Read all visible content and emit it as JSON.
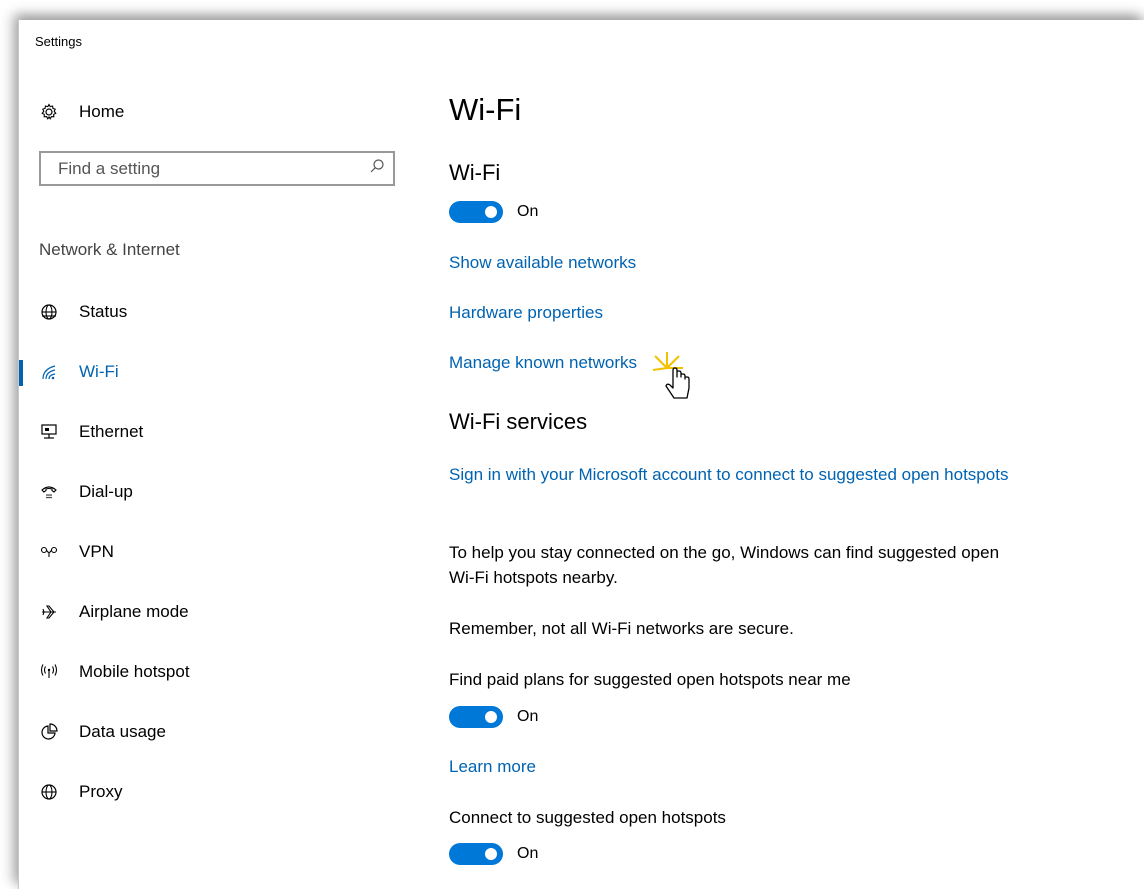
{
  "window": {
    "title": "Settings"
  },
  "sidebar": {
    "home_label": "Home",
    "search": {
      "placeholder": "Find a setting"
    },
    "section_heading": "Network & Internet",
    "items": [
      {
        "label": "Status",
        "icon": "globe-status-icon"
      },
      {
        "label": "Wi-Fi",
        "icon": "wifi-icon",
        "active": true
      },
      {
        "label": "Ethernet",
        "icon": "ethernet-icon"
      },
      {
        "label": "Dial-up",
        "icon": "phone-icon"
      },
      {
        "label": "VPN",
        "icon": "vpn-icon"
      },
      {
        "label": "Airplane mode",
        "icon": "airplane-icon"
      },
      {
        "label": "Mobile hotspot",
        "icon": "hotspot-icon"
      },
      {
        "label": "Data usage",
        "icon": "pie-chart-icon"
      },
      {
        "label": "Proxy",
        "icon": "globe-icon"
      }
    ]
  },
  "main": {
    "page_title": "Wi-Fi",
    "wifi_heading": "Wi-Fi",
    "wifi_toggle_label": "On",
    "links": {
      "show_networks": "Show available networks",
      "hardware_properties": "Hardware properties",
      "manage_known": "Manage known networks"
    },
    "services_heading": "Wi-Fi services",
    "sign_in_link": "Sign in with your Microsoft account to connect to suggested open hotspots",
    "help_text": "To help you stay connected on the go, Windows can find suggested open Wi-Fi hotspots nearby.",
    "remember_text": "Remember, not all Wi-Fi networks are secure.",
    "paid_plans_label": "Find paid plans for suggested open hotspots near me",
    "paid_plans_toggle": "On",
    "learn_more": "Learn more",
    "connect_label": "Connect to suggested open hotspots",
    "connect_toggle": "On"
  },
  "colors": {
    "accent": "#0078d7",
    "link": "#0063b1"
  }
}
